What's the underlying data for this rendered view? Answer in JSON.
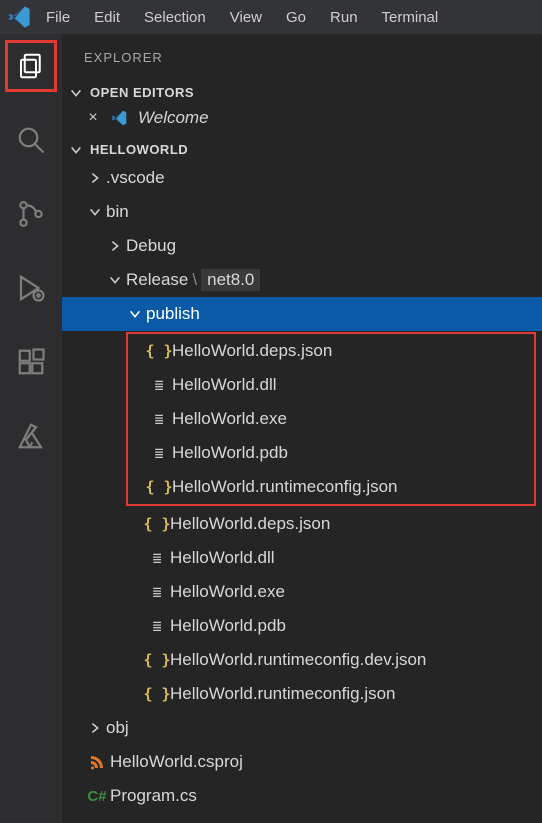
{
  "menu": {
    "items": [
      "File",
      "Edit",
      "Selection",
      "View",
      "Go",
      "Run",
      "Terminal"
    ]
  },
  "sidebar": {
    "title": "EXPLORER",
    "openEditors": {
      "label": "OPEN EDITORS",
      "entries": [
        {
          "name": "Welcome"
        }
      ]
    },
    "workspace": {
      "label": "HELLOWORLD",
      "tree": {
        "vscode_folder": ".vscode",
        "bin": "bin",
        "debug": "Debug",
        "release": "Release",
        "release_suffix_sep": "\\",
        "release_suffix": "net8.0",
        "publish": "publish",
        "publish_files": [
          {
            "name": "HelloWorld.deps.json",
            "icon": "json"
          },
          {
            "name": "HelloWorld.dll",
            "icon": "asm"
          },
          {
            "name": "HelloWorld.exe",
            "icon": "asm"
          },
          {
            "name": "HelloWorld.pdb",
            "icon": "asm"
          },
          {
            "name": "HelloWorld.runtimeconfig.json",
            "icon": "json"
          }
        ],
        "release_files": [
          {
            "name": "HelloWorld.deps.json",
            "icon": "json"
          },
          {
            "name": "HelloWorld.dll",
            "icon": "asm"
          },
          {
            "name": "HelloWorld.exe",
            "icon": "asm"
          },
          {
            "name": "HelloWorld.pdb",
            "icon": "asm"
          },
          {
            "name": "HelloWorld.runtimeconfig.dev.json",
            "icon": "json"
          },
          {
            "name": "HelloWorld.runtimeconfig.json",
            "icon": "json"
          }
        ],
        "obj": "obj",
        "csproj": "HelloWorld.csproj",
        "program": "Program.cs"
      }
    }
  }
}
